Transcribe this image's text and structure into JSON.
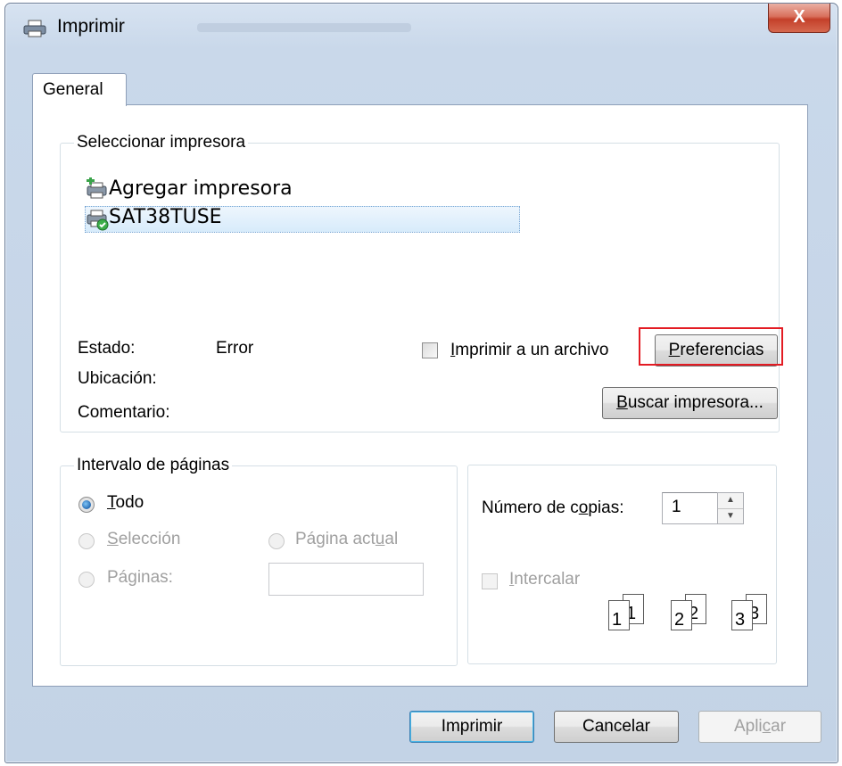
{
  "window": {
    "title": "Imprimir",
    "close_label": "X"
  },
  "tabs": [
    {
      "label": "General",
      "selected": true
    }
  ],
  "select_printer": {
    "legend": "Seleccionar impresora",
    "printers": [
      {
        "name": "Agregar impresora",
        "icon": "add-printer-icon",
        "selected": false
      },
      {
        "name": "SAT38TUSE",
        "icon": "printer-ready-icon",
        "selected": true
      }
    ],
    "status_label": "Estado:",
    "status_value": "Error",
    "location_label": "Ubicación:",
    "comment_label": "Comentario:",
    "print_to_file": {
      "label_prefix": "",
      "label_mnemonic": "I",
      "label_rest": "mprimir a un archivo",
      "checked": false
    },
    "preferences_button": {
      "mnemonic": "P",
      "rest": "referencias",
      "highlight_color": "#e31b23"
    },
    "find_printer_button": {
      "mnemonic": "B",
      "rest": "uscar impresora..."
    }
  },
  "page_range": {
    "legend": "Intervalo de páginas",
    "all": {
      "mnemonic": "T",
      "rest": "odo",
      "checked": true,
      "enabled": true
    },
    "selection": {
      "mnemonic": "S",
      "rest": "elección",
      "checked": false,
      "enabled": false
    },
    "current_page": {
      "prefix": "Página act",
      "mnemonic": "u",
      "rest": "al",
      "checked": false,
      "enabled": false
    },
    "pages": {
      "prefix": "Pá",
      "mnemonic": "g",
      "rest": "inas:",
      "checked": false,
      "enabled": false
    },
    "pages_input": {
      "value": ""
    }
  },
  "copies": {
    "label_prefix": "Número de c",
    "label_mnemonic": "o",
    "label_rest": "pias:",
    "value": "1",
    "collate": {
      "mnemonic": "I",
      "rest": "ntercalar",
      "checked": false,
      "enabled": false
    },
    "collate_pages": [
      "1",
      "1",
      "2",
      "2",
      "3",
      "3"
    ]
  },
  "buttons": {
    "print": "Imprimir",
    "cancel": "Cancelar",
    "apply_prefix": "Apli",
    "apply_mnemonic": "c",
    "apply_rest": "ar"
  },
  "colors": {
    "selection_highlight": "#d7ebfb",
    "annotation_red": "#e31b23"
  }
}
